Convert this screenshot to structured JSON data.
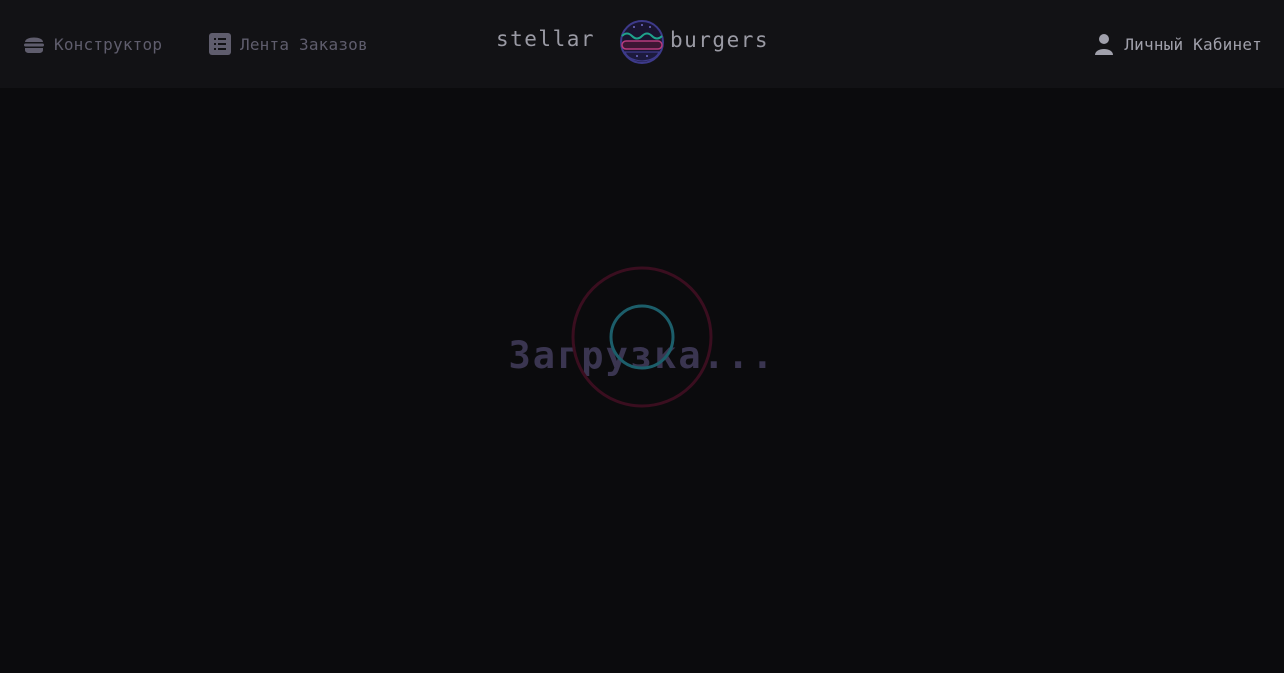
{
  "header": {
    "nav": {
      "constructor_label": "Конструктор",
      "feed_label": "Лента Заказов",
      "account_label": "Личный Кабинет"
    },
    "logo": {
      "left_word": "stellar",
      "right_word": "burgers"
    }
  },
  "main": {
    "loading_text": "Загрузка..."
  },
  "icons": {
    "constructor": "burger-icon",
    "feed": "list-icon",
    "account": "profile-icon"
  },
  "colors": {
    "background": "#0b0b0d",
    "header": "#121215",
    "nav_inactive": "#5f5d6d",
    "nav_account": "#a0a0ab",
    "loading_text": "#3a3550",
    "spinner_outer": "#3a0e1f",
    "spinner_inner": "#1c5e6a"
  }
}
